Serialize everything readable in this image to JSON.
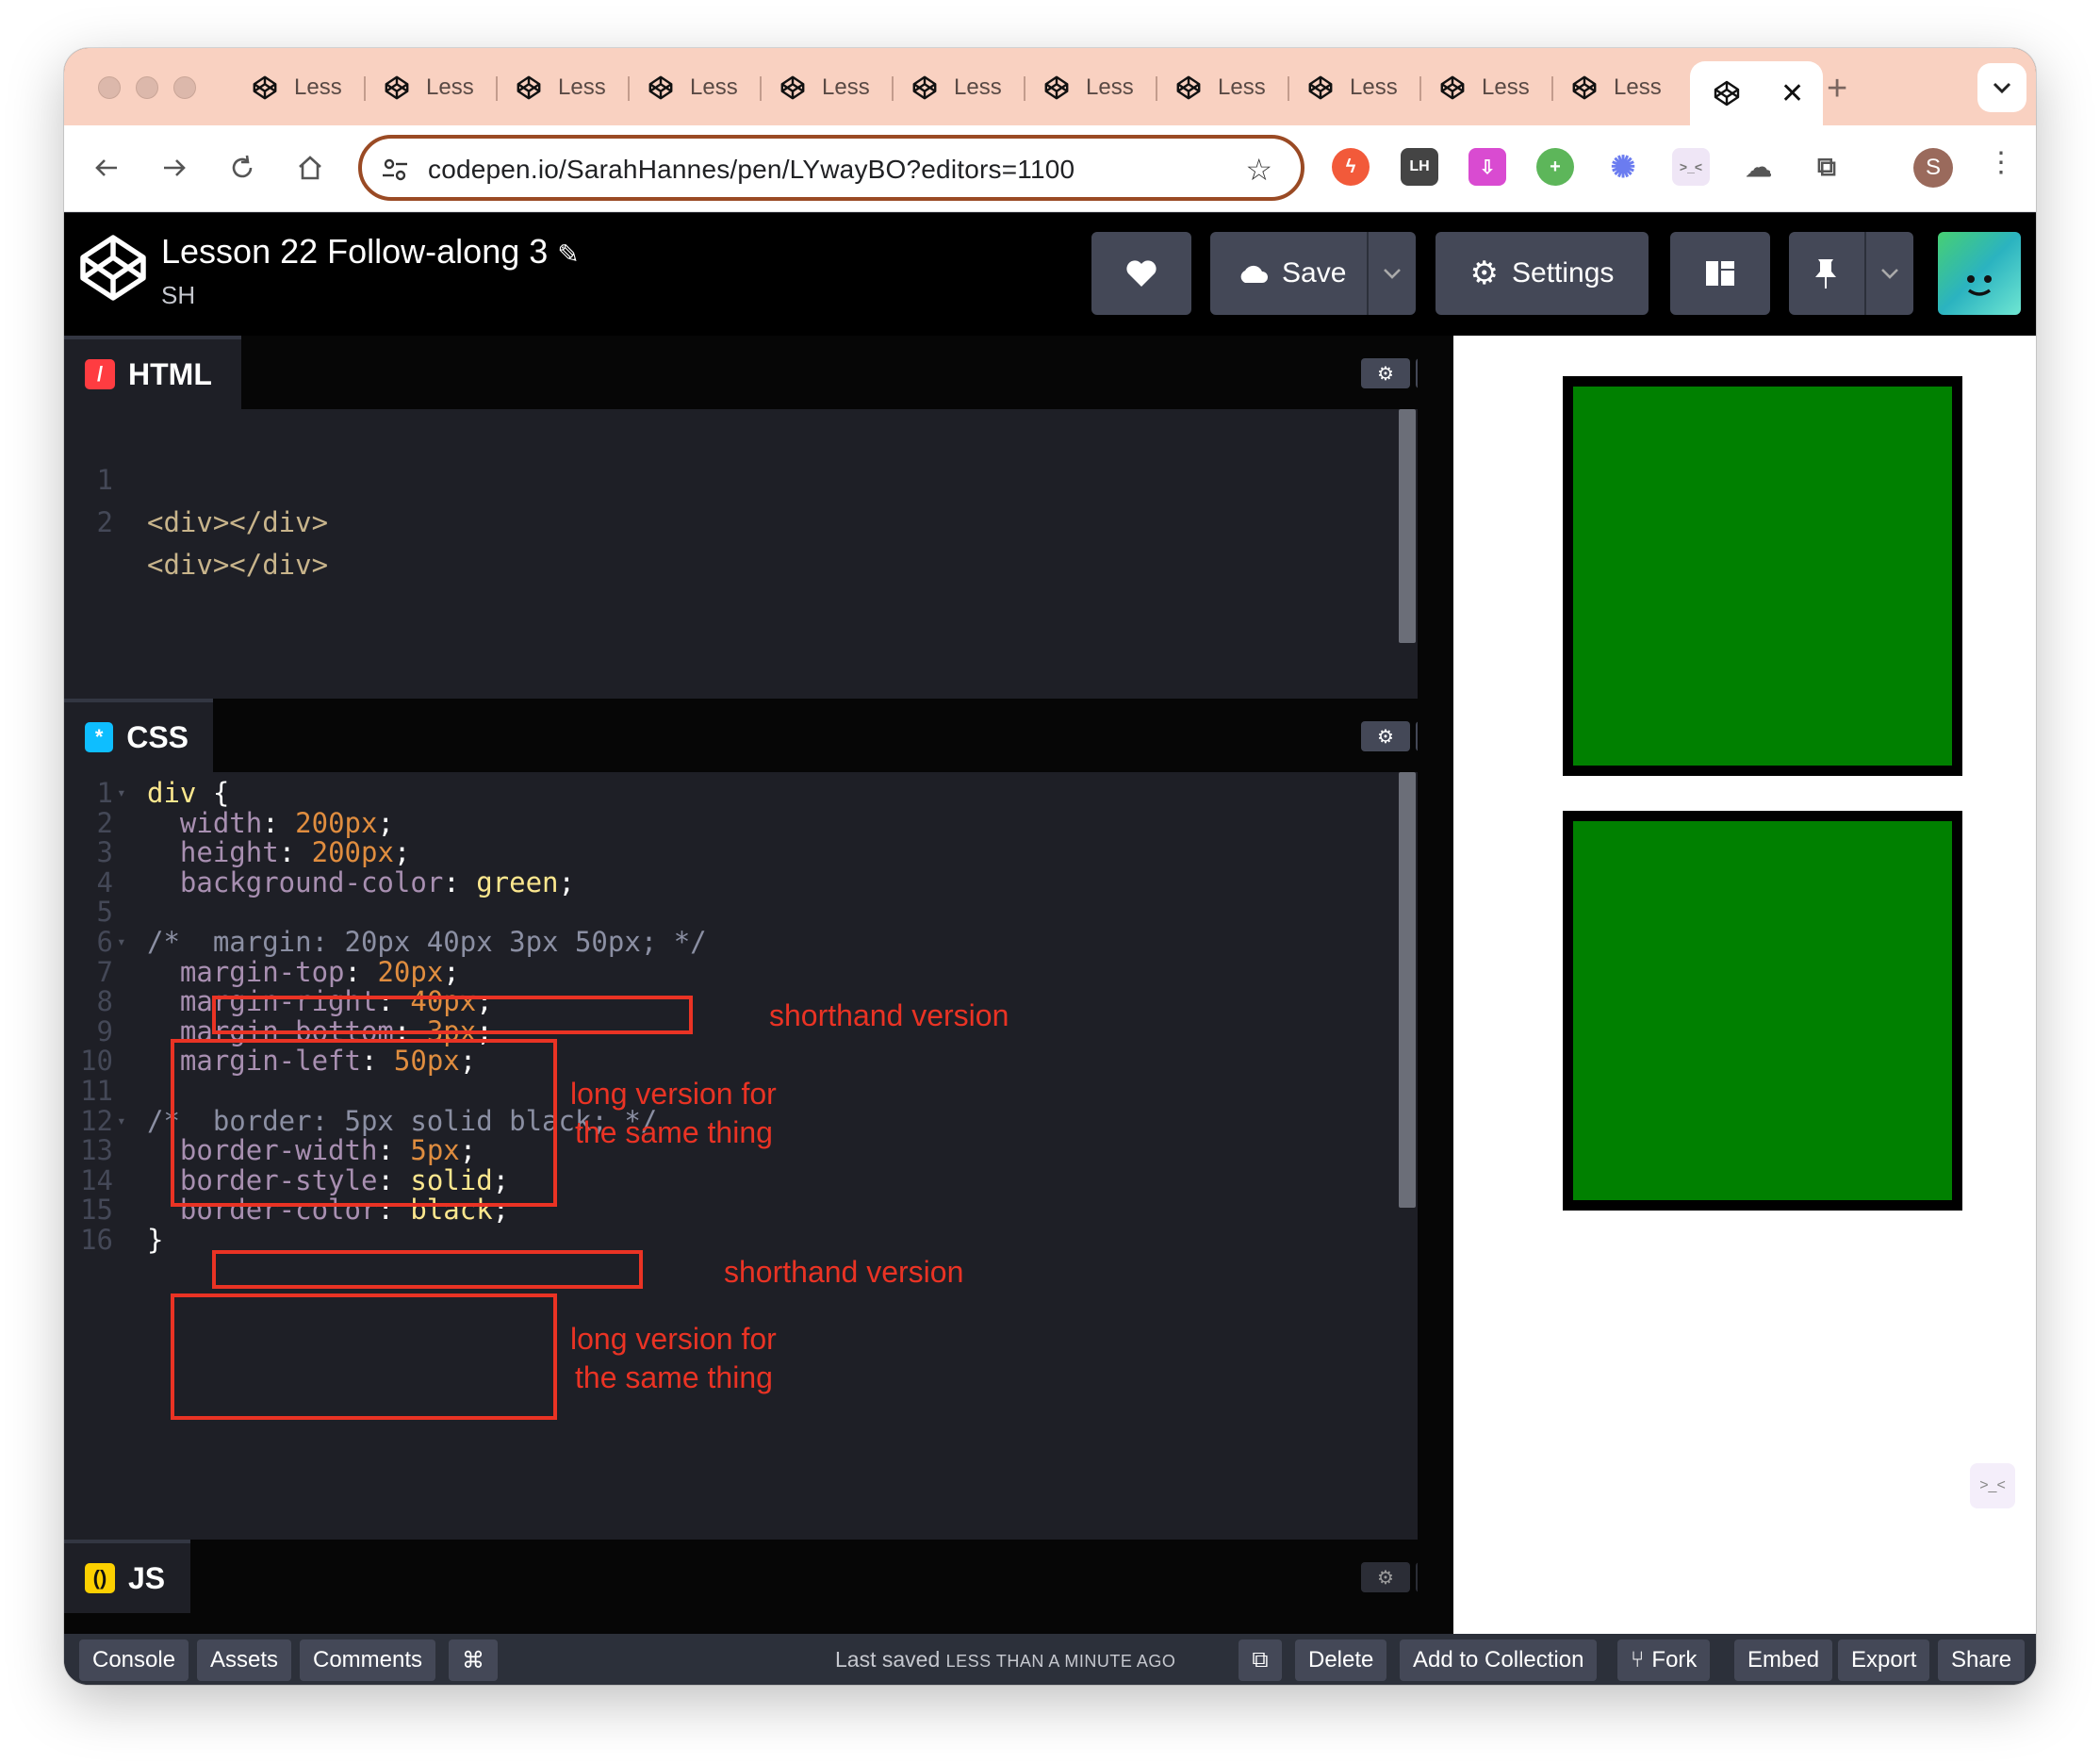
{
  "browser": {
    "tabs": [
      {
        "label": "Less"
      },
      {
        "label": "Less"
      },
      {
        "label": "Less"
      },
      {
        "label": "Less"
      },
      {
        "label": "Less"
      },
      {
        "label": "Less"
      },
      {
        "label": "Less"
      },
      {
        "label": "Less"
      },
      {
        "label": "Less"
      },
      {
        "label": "Less"
      },
      {
        "label": "Less"
      }
    ],
    "active_tab_close": "✕",
    "new_tab": "+",
    "url": "codepen.io/SarahHannes/pen/LYwayBO?editors=1100",
    "avatar_initial": "S"
  },
  "header": {
    "title": "Lesson 22 Follow-along 3",
    "author": "SH",
    "save_label": "Save",
    "settings_label": "Settings"
  },
  "editors": {
    "html": {
      "label": "HTML",
      "lines": [
        {
          "n": "1",
          "text": "<div></div>"
        },
        {
          "n": "2",
          "text": "<div></div>"
        }
      ]
    },
    "css": {
      "label": "CSS",
      "line_numbers": [
        "1",
        "2",
        "3",
        "4",
        "5",
        "6",
        "7",
        "8",
        "9",
        "10",
        "11",
        "12",
        "13",
        "14",
        "15",
        "16"
      ],
      "lines": [
        "div {",
        "  width: 200px;",
        "  height: 200px;",
        "  background-color: green;",
        "",
        "/*  margin: 20px 40px 3px 50px; */",
        "  margin-top: 20px;",
        "  margin-right: 40px;",
        "  margin-bottom: 3px;",
        "  margin-left: 50px;",
        "",
        "/*  border: 5px solid black; */",
        "  border-width: 5px;",
        "  border-style: solid;",
        "  border-color: black;",
        "}"
      ]
    },
    "js": {
      "label": "JS"
    }
  },
  "annotations": {
    "margin_short": "shorthand version",
    "margin_long_1": "long version for",
    "margin_long_2": "the same thing",
    "border_short": "shorthand version",
    "border_long_1": "long version for",
    "border_long_2": "the same thing"
  },
  "footer": {
    "console": "Console",
    "assets": "Assets",
    "comments": "Comments",
    "shortcut": "⌘",
    "saved_prefix": "Last saved",
    "saved_time": "LESS THAN A MINUTE AGO",
    "delete": "Delete",
    "add_to_collection": "Add to Collection",
    "fork": "Fork",
    "embed": "Embed",
    "export": "Export",
    "share": "Share"
  },
  "colors": {
    "accent_tab_bg": "#f9d1c1",
    "editor_bg": "#1e1f26",
    "annotation_red": "#ea3324",
    "preview_box": "#008000"
  }
}
